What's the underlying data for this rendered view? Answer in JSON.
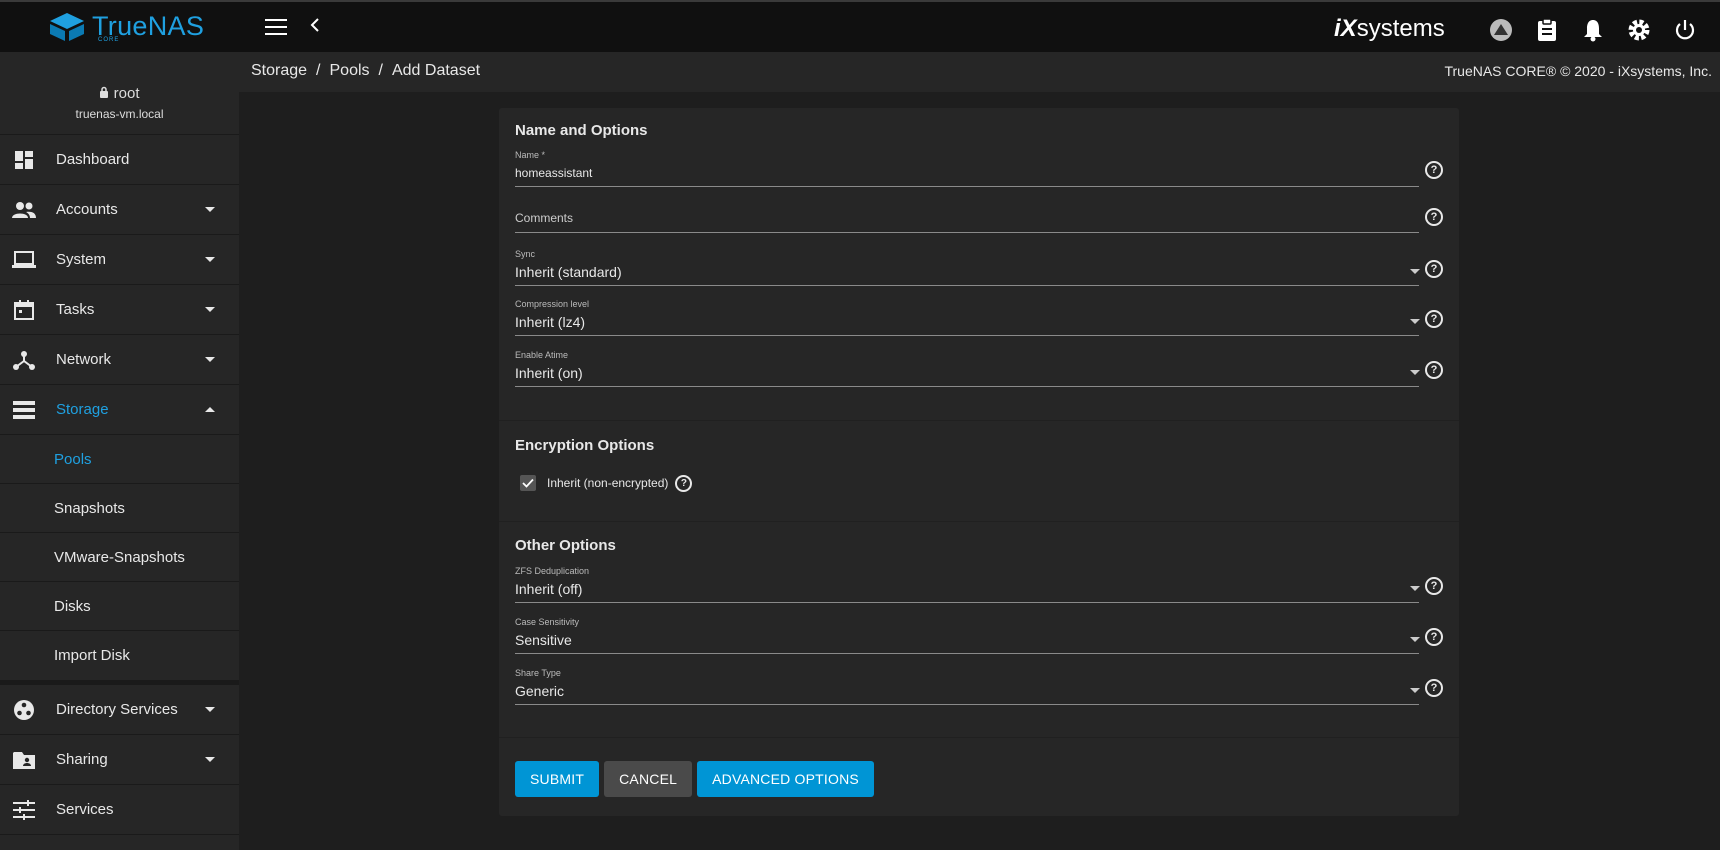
{
  "topbar": {
    "brand": "TrueNAS",
    "brand_sub": "CORE",
    "vendor_logo_prefix": "iX",
    "vendor_logo_suffix": "systems",
    "icons": [
      "truecommand-icon",
      "clipboard-icon",
      "bell-icon",
      "gear-icon",
      "power-icon"
    ]
  },
  "user": {
    "name": "root",
    "host": "truenas-vm.local"
  },
  "sidebar": {
    "items": [
      {
        "label": "Dashboard"
      },
      {
        "label": "Accounts"
      },
      {
        "label": "System"
      },
      {
        "label": "Tasks"
      },
      {
        "label": "Network"
      },
      {
        "label": "Storage"
      },
      {
        "label": "Directory Services"
      },
      {
        "label": "Sharing"
      },
      {
        "label": "Services"
      }
    ],
    "storage_sub": [
      {
        "label": "Pools"
      },
      {
        "label": "Snapshots"
      },
      {
        "label": "VMware-Snapshots"
      },
      {
        "label": "Disks"
      },
      {
        "label": "Import Disk"
      }
    ]
  },
  "breadcrumb": {
    "items": [
      "Storage",
      "Pools",
      "Add Dataset"
    ],
    "separator": "/"
  },
  "copyright": "TrueNAS CORE® © 2020 - iXsystems, Inc.",
  "form": {
    "section1_title": "Name and Options",
    "name": {
      "label": "Name *",
      "value": "homeassistant"
    },
    "comments": {
      "placeholder": "Comments",
      "value": ""
    },
    "sync": {
      "label": "Sync",
      "value": "Inherit (standard)"
    },
    "compression": {
      "label": "Compression level",
      "value": "Inherit (lz4)"
    },
    "atime": {
      "label": "Enable Atime",
      "value": "Inherit (on)"
    },
    "section2_title": "Encryption Options",
    "encryption": {
      "label": "Inherit (non-encrypted)",
      "checked": true
    },
    "section3_title": "Other Options",
    "dedup": {
      "label": "ZFS Deduplication",
      "value": "Inherit (off)"
    },
    "case": {
      "label": "Case Sensitivity",
      "value": "Sensitive"
    },
    "share": {
      "label": "Share Type",
      "value": "Generic"
    },
    "buttons": {
      "submit": "SUBMIT",
      "cancel": "CANCEL",
      "advanced": "ADVANCED OPTIONS"
    },
    "help_glyph": "?"
  },
  "colors": {
    "accent": "#1fa0e0",
    "primary_button": "#0095d5",
    "background": "#1e1e1e",
    "panel": "#262626"
  }
}
